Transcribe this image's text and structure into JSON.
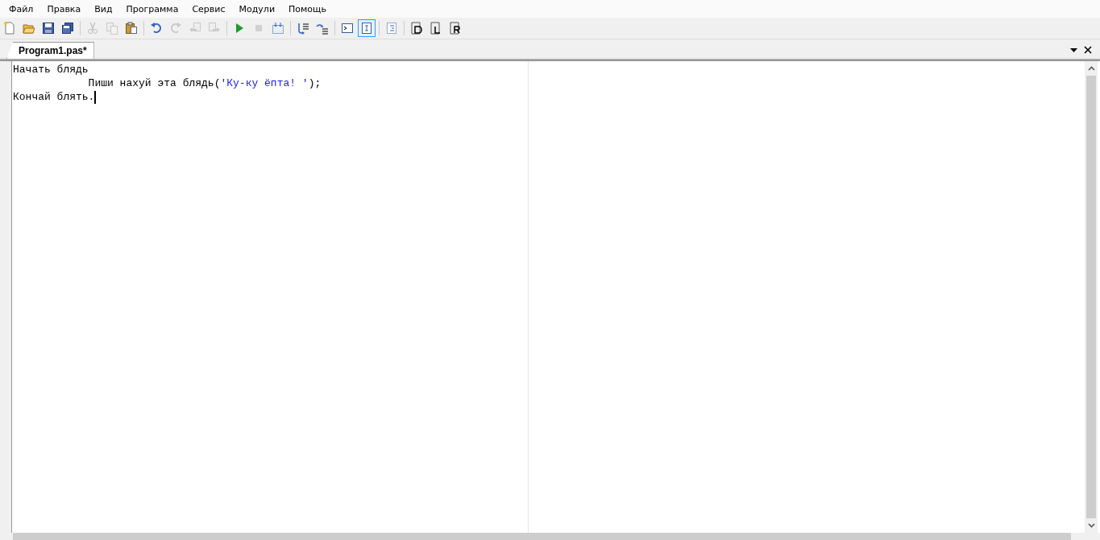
{
  "menu": [
    {
      "label": "Файл"
    },
    {
      "label": "Правка"
    },
    {
      "label": "Вид"
    },
    {
      "label": "Программа"
    },
    {
      "label": "Сервис"
    },
    {
      "label": "Модули"
    },
    {
      "label": "Помощь"
    }
  ],
  "toolbar": [
    {
      "kind": "new",
      "disabled": false,
      "pressed": false
    },
    {
      "kind": "open",
      "disabled": false,
      "pressed": false
    },
    {
      "kind": "save",
      "disabled": false,
      "pressed": false
    },
    {
      "kind": "save-all",
      "disabled": false,
      "pressed": false
    },
    {
      "kind": "separator"
    },
    {
      "kind": "cut",
      "disabled": true,
      "pressed": false
    },
    {
      "kind": "copy",
      "disabled": true,
      "pressed": false
    },
    {
      "kind": "paste",
      "disabled": false,
      "pressed": false
    },
    {
      "kind": "separator"
    },
    {
      "kind": "undo",
      "disabled": false,
      "pressed": false
    },
    {
      "kind": "redo",
      "disabled": true,
      "pressed": false
    },
    {
      "kind": "back",
      "disabled": true,
      "pressed": false
    },
    {
      "kind": "forward",
      "disabled": true,
      "pressed": false
    },
    {
      "kind": "separator"
    },
    {
      "kind": "run",
      "disabled": false,
      "pressed": false
    },
    {
      "kind": "stop",
      "disabled": true,
      "pressed": false
    },
    {
      "kind": "compile",
      "disabled": false,
      "pressed": false
    },
    {
      "kind": "separator"
    },
    {
      "kind": "step-into",
      "disabled": false,
      "pressed": false
    },
    {
      "kind": "step-over",
      "disabled": false,
      "pressed": false
    },
    {
      "kind": "separator"
    },
    {
      "kind": "console",
      "disabled": false,
      "pressed": false
    },
    {
      "kind": "output",
      "disabled": false,
      "pressed": true
    },
    {
      "kind": "separator"
    },
    {
      "kind": "format",
      "disabled": false,
      "pressed": false
    },
    {
      "kind": "separator"
    },
    {
      "kind": "doc-d",
      "disabled": false,
      "pressed": false
    },
    {
      "kind": "doc-l",
      "disabled": false,
      "pressed": false
    },
    {
      "kind": "doc-r",
      "disabled": false,
      "pressed": false
    }
  ],
  "tabs": [
    {
      "label": "Program1.pas*",
      "selected": true
    }
  ],
  "editor": {
    "lines": [
      {
        "cursor": false,
        "segments": [
          {
            "kind": "plain",
            "text": "Начать блядь"
          }
        ]
      },
      {
        "cursor": false,
        "segments": [
          {
            "kind": "plain",
            "text": "            Пиши нахуй эта блядь("
          },
          {
            "kind": "string",
            "text": "'Ку-ку ёпта! '"
          },
          {
            "kind": "plain",
            "text": ");"
          }
        ]
      },
      {
        "cursor": true,
        "segments": [
          {
            "kind": "plain",
            "text": "Кончай блять."
          }
        ]
      }
    ]
  }
}
